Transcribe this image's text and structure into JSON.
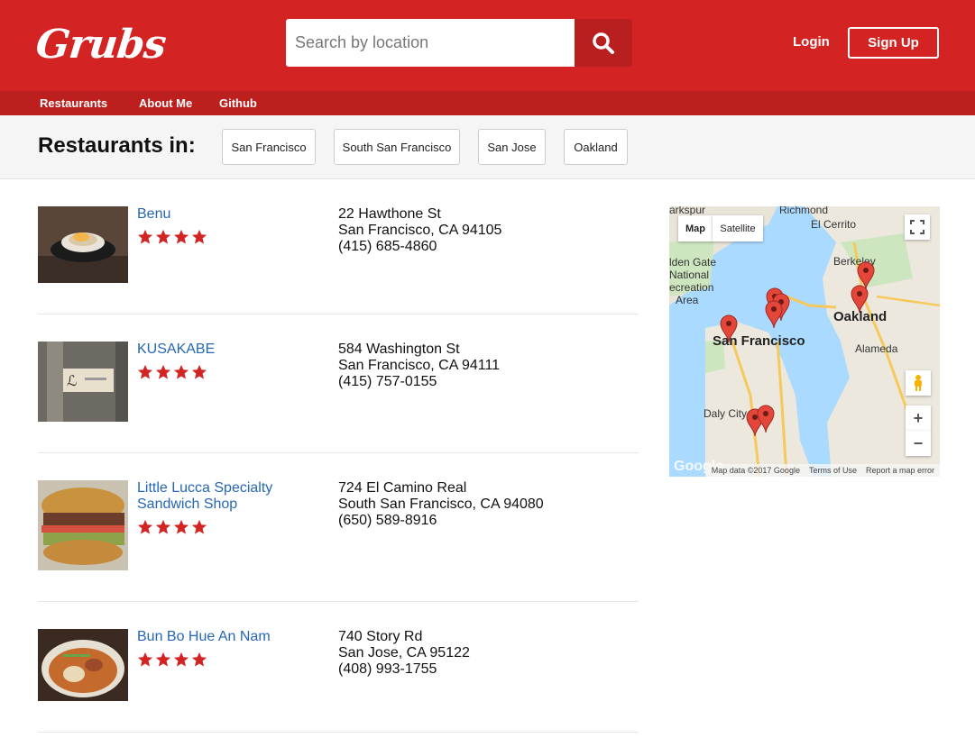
{
  "header": {
    "logo": "Grubs",
    "search_placeholder": "Search by location",
    "login": "Login",
    "signup": "Sign Up"
  },
  "subnav": [
    "Restaurants",
    "About Me",
    "Github"
  ],
  "citybar": {
    "heading": "Restaurants in:",
    "cities": [
      "San Francisco",
      "South San Francisco",
      "San Jose",
      "Oakland"
    ]
  },
  "restaurants": [
    {
      "name": "Benu",
      "rating": 4,
      "address1": "22 Hawthone St",
      "address2": "San Francisco, CA 94105",
      "phone": "(415) 685-4860"
    },
    {
      "name": "KUSAKABE",
      "rating": 4,
      "address1": "584 Washington St",
      "address2": "San Francisco, CA 94111",
      "phone": "(415) 757-0155"
    },
    {
      "name": "Little Lucca Specialty Sandwich Shop",
      "rating": 4,
      "address1": "724 El Camino Real",
      "address2": "South San Francisco, CA 94080",
      "phone": "(650) 589-8916"
    },
    {
      "name": "Bun Bo Hue An Nam",
      "rating": 4,
      "address1": "740 Story Rd",
      "address2": "San Jose, CA 95122",
      "phone": "(408) 993-1755"
    }
  ],
  "map": {
    "type_map": "Map",
    "type_satellite": "Satellite",
    "labels": {
      "richmond": "Richmond",
      "el_cerrito": "El Cerrito",
      "larkspur": "arkspur",
      "golden_gate": "lden Gate",
      "national": "National",
      "recreation": "ecreation",
      "area": "Area",
      "berkeley": "Berkeley",
      "oakland": "Oakland",
      "san_francisco": "San Francisco",
      "alameda": "Alameda",
      "daly_city": "Daly City"
    },
    "footer_data": "Map data ©2017 Google",
    "footer_terms": "Terms of Use",
    "footer_report": "Report a map error",
    "google": "Google",
    "zoom_in": "+",
    "zoom_out": "−"
  },
  "colors": {
    "brand": "#d32323",
    "link": "#2567b3"
  }
}
